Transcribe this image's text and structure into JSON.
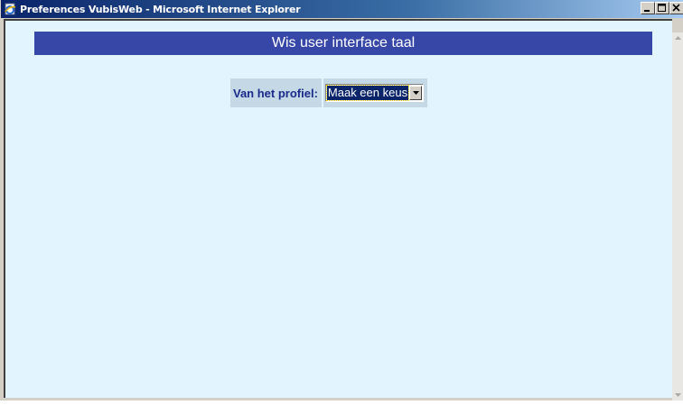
{
  "window": {
    "title": "Preferences VubisWeb - Microsoft Internet Explorer",
    "icon": "ie-page-icon",
    "controls": {
      "minimize": "_",
      "maximize": "□",
      "close": "x"
    }
  },
  "page": {
    "header": "Wis user interface taal",
    "form": {
      "profile_label": "Van het profiel:",
      "profile_select": {
        "selected": "Maak een keus"
      }
    }
  },
  "colors": {
    "page_background": "#e2f4fe",
    "header_background": "#3747a8",
    "label_text": "#1a2a8a",
    "cell_background": "#c4d8e6"
  }
}
